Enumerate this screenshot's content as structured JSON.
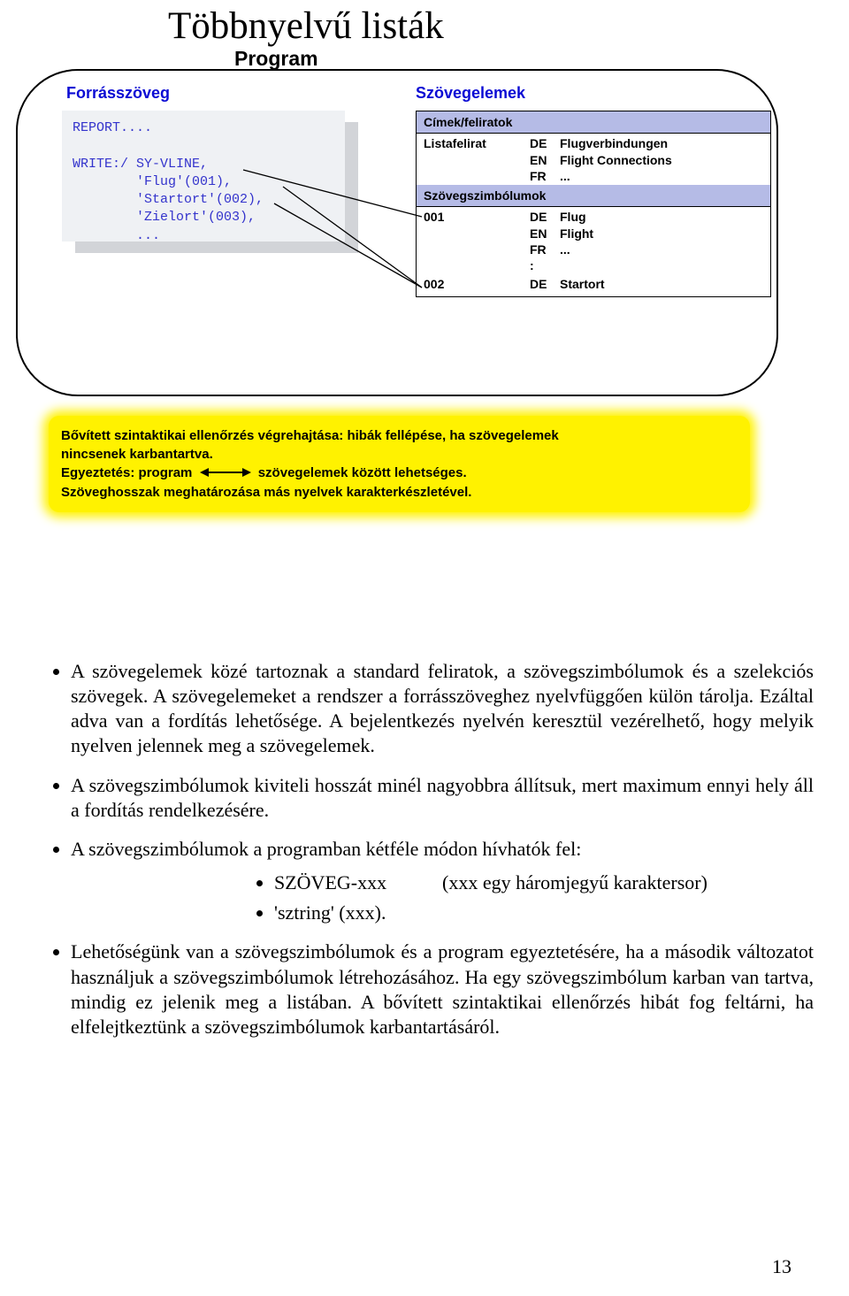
{
  "slide": {
    "title": "Többnyelvű listák",
    "subtitle": "Program",
    "left_col_title": "Forrásszöveg",
    "right_col_title": "Szövegelemek",
    "code": "REPORT....\n\nWRITE:/ SY-VLINE,\n        'Flug'(001),\n        'Startort'(002),\n        'Zielort'(003),\n        ...",
    "table": {
      "h1": "Címek/feliratok",
      "row1": {
        "label": "Listafelirat",
        "de": "DE",
        "de_txt": "Flugverbindungen",
        "en": "EN",
        "en_txt": "Flight Connections",
        "fr": "FR",
        "fr_txt": "..."
      },
      "h2": "Szövegszimbólumok",
      "row001": {
        "id": "001",
        "de": "DE",
        "de_txt": "Flug",
        "en": "EN",
        "en_txt": "Flight",
        "fr": "FR",
        "fr_txt": "...",
        "colon": ":"
      },
      "row002": {
        "id": "002",
        "de": "DE",
        "de_txt": "Startort"
      }
    },
    "highlight": {
      "l1": "Bővített szintaktikai ellenőrzés végrehajtása: hibák fellépése, ha szövegelemek",
      "l2": "nincsenek karbantartva.",
      "l3a": "Egyeztetés:  program",
      "l3b": "szövegelemek között lehetséges.",
      "l4": "Szöveghosszak meghatározása más nyelvek karakterkészletével."
    }
  },
  "body": {
    "p1": "A szövegelemek közé tartoznak a standard feliratok, a szövegszimbólumok és a szelekciós szövegek. A szövegelemeket a rendszer a forrásszöveghez nyelvfüggően külön tárolja. Ezáltal adva van a fordítás lehetősége. A bejelentkezés nyelvén keresztül vezérelhető, hogy melyik nyelven jelennek meg a szövegelemek.",
    "p2": "A szövegszimbólumok kiviteli hosszát minél nagyobbra állítsuk, mert maximum ennyi hely áll a fordítás rendelkezésére.",
    "p3": "A szövegszimbólumok a programban kétféle módon hívhatók fel:",
    "sub1a": "SZÖVEG-xxx",
    "sub1b": "(xxx egy háromjegyű karaktersor)",
    "sub2": "'sztring' (xxx).",
    "p4": "Lehetőségünk van a szövegszimbólumok és a program egyeztetésére, ha a második változatot használjuk a szövegszimbólumok létrehozásához. Ha egy szövegszimbólum karban van tartva, mindig ez jelenik meg a listában. A bővített szintaktikai ellenőrzés hibát fog feltárni, ha elfelejtkeztünk a szövegszimbólumok karbantartásáról."
  },
  "page_number": "13"
}
